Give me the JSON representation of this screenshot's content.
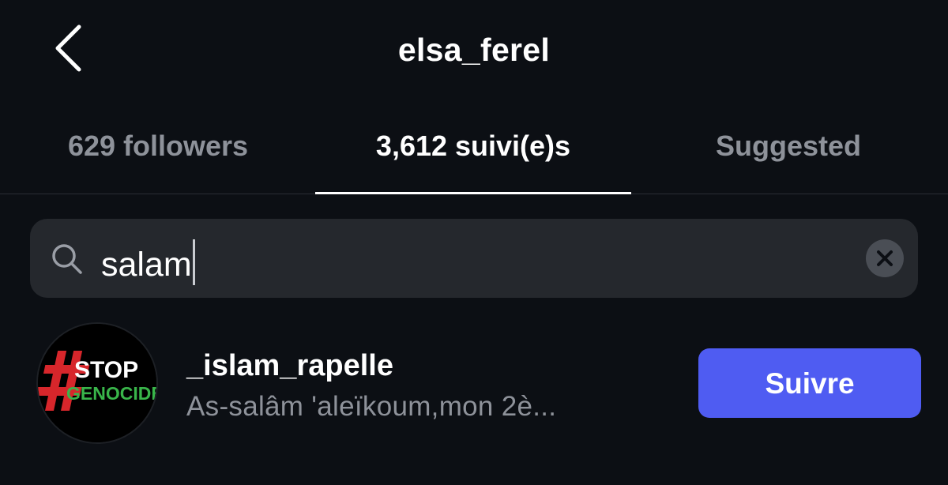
{
  "header": {
    "title": "elsa_ferel",
    "back_icon": "chevron-left-icon"
  },
  "tabs": [
    {
      "label": "629 followers",
      "active": false
    },
    {
      "label": "3,612 suivi(e)s",
      "active": true
    },
    {
      "label": "Suggested",
      "active": false
    }
  ],
  "search": {
    "icon": "search-icon",
    "value": "salam",
    "clear_icon": "close-icon"
  },
  "results": [
    {
      "username": "_islam_rapelle",
      "bio": "As-salâm 'aleïkoum,mon 2è...",
      "avatar_text_line1": "STOP",
      "avatar_text_line2": "GENOCIDE",
      "follow_label": "Suivre"
    }
  ],
  "colors": {
    "background": "#0c0f14",
    "search_bg": "#25282d",
    "inactive_text": "#8e929a",
    "follow_button": "#4f5cf2",
    "avatar_hash_red": "#d7262b",
    "avatar_green": "#39b54a"
  }
}
